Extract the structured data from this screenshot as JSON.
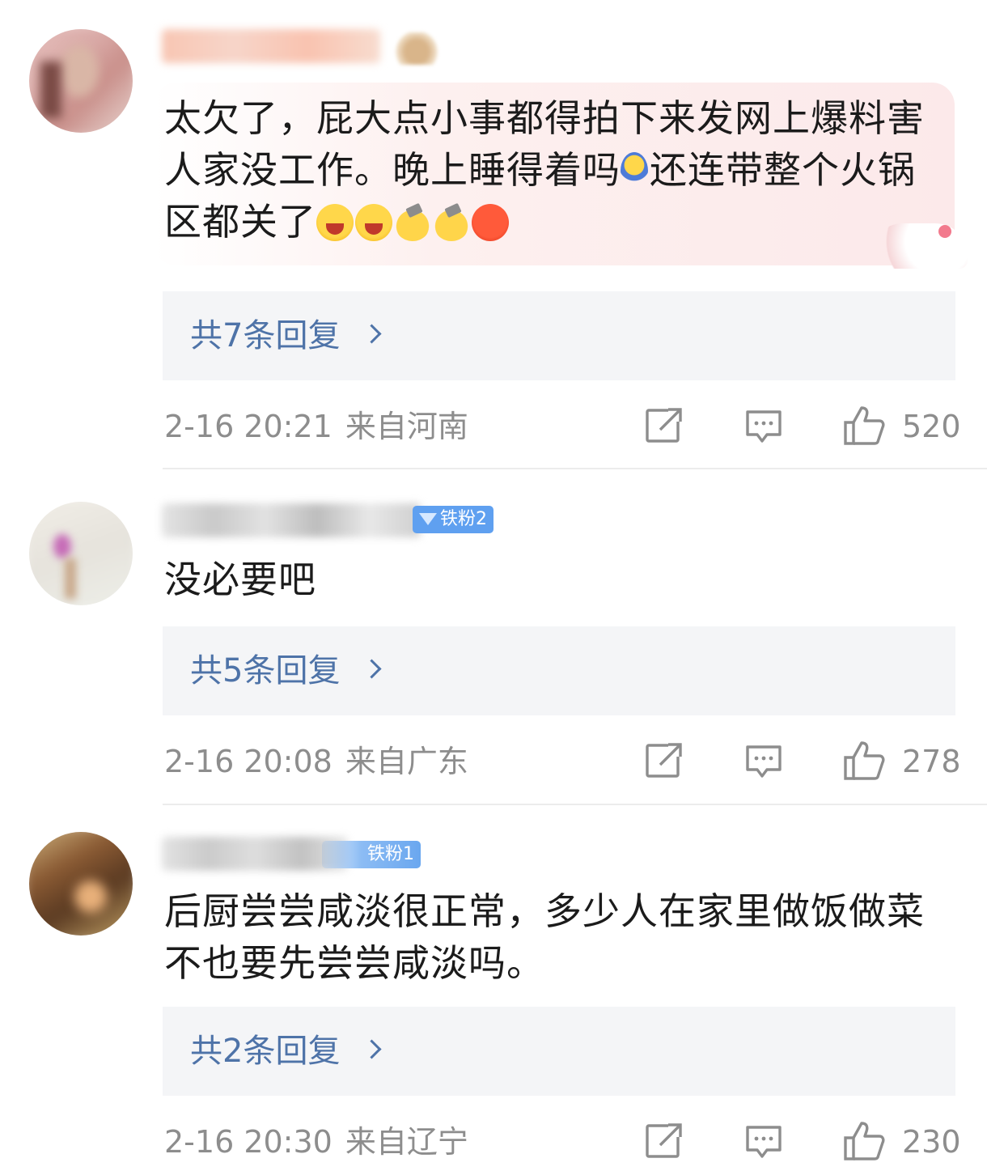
{
  "comments": [
    {
      "text_parts": [
        "太欠了，屁大点小事都得拍下来发网上爆料害人家没工作。晚上睡得着吗",
        "还连带整个火锅区都关了"
      ],
      "emojis_after_text": [
        "crying-face-emoji",
        "crying-face-emoji",
        "hammer-emoji",
        "hammer-emoji",
        "angry-face-emoji"
      ],
      "inline_emoji": "sleeping-kid-emoji",
      "reply_label": "共7条回复",
      "time": "2-16 20:21",
      "location": "来自河南",
      "likes": "520",
      "badge": ""
    },
    {
      "text_parts": [
        "没必要吧"
      ],
      "reply_label": "共5条回复",
      "time": "2-16 20:08",
      "location": "来自广东",
      "likes": "278",
      "badge": "铁粉2"
    },
    {
      "text_parts": [
        "后厨尝尝咸淡很正常，多少人在家里做饭做菜不也要先尝尝咸淡吗。"
      ],
      "reply_label": "共2条回复",
      "time": "2-16 20:30",
      "location": "来自辽宁",
      "likes": "230",
      "badge": "铁粉1"
    }
  ],
  "colors": {
    "link": "#4e73a8",
    "meta_text": "#8d8d8d",
    "badge": "#5fa0f0",
    "reply_box": "#f4f5f7"
  },
  "icons": [
    "share-icon",
    "comment-icon",
    "like-icon",
    "chevron-right-icon"
  ]
}
